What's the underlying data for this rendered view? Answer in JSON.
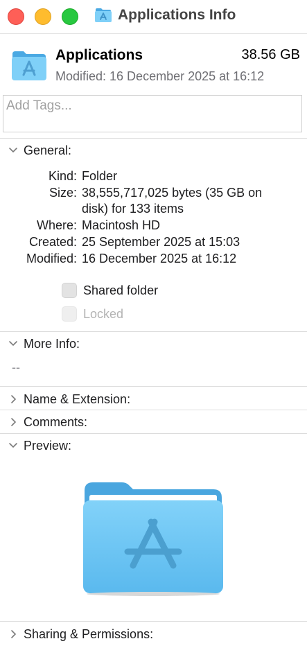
{
  "window": {
    "title": "Applications Info"
  },
  "header": {
    "name": "Applications",
    "size": "38.56 GB",
    "modified": "Modified: 16 December 2025 at 16:12"
  },
  "tags": {
    "placeholder": "Add Tags..."
  },
  "general": {
    "label": "General:",
    "rows": [
      {
        "key": "Kind:",
        "value": "Folder"
      },
      {
        "key": "Size:",
        "value": "38,555,717,025 bytes (35 GB on disk) for 133 items"
      },
      {
        "key": "Where:",
        "value": "Macintosh HD"
      },
      {
        "key": "Created:",
        "value": "25 September 2025 at 15:03"
      },
      {
        "key": "Modified:",
        "value": "16 December 2025 at 16:12"
      }
    ],
    "shared_folder": {
      "label": "Shared folder",
      "checked": false
    },
    "locked": {
      "label": "Locked",
      "checked": false,
      "enabled": false
    }
  },
  "more_info": {
    "label": "More Info:",
    "value": "--"
  },
  "name_extension": {
    "label": "Name & Extension:"
  },
  "comments": {
    "label": "Comments:"
  },
  "preview": {
    "label": "Preview:"
  },
  "sharing": {
    "label": "Sharing & Permissions:"
  },
  "colors": {
    "folder_light": "#7fd0f8",
    "folder_dark": "#4aa9e3",
    "close": "#fe5f57",
    "minimize": "#febc2e",
    "zoom": "#28c840"
  },
  "icons": {
    "title": "applications-folder-icon",
    "header": "applications-folder-icon",
    "preview": "applications-folder-icon"
  }
}
